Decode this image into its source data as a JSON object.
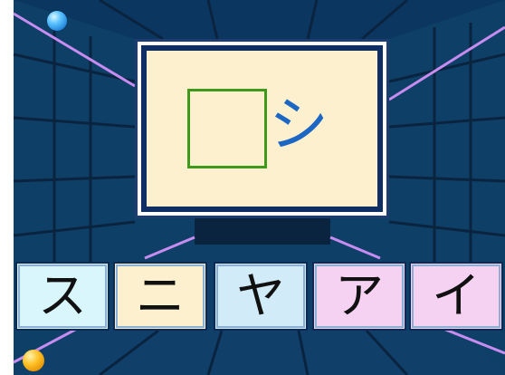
{
  "question": {
    "given_kana": "シ",
    "blank_slot": "empty"
  },
  "choices": [
    {
      "kana": "ス"
    },
    {
      "kana": "ニ"
    },
    {
      "kana": "ヤ"
    },
    {
      "kana": "ア"
    },
    {
      "kana": "イ"
    }
  ],
  "colors": {
    "background": "#0e3f66",
    "card_fill": "#fdf0cf",
    "card_border": "#0f2e64",
    "slot_border": "#3f9a1b",
    "given_kana": "#1c66c4",
    "neon_line": "#c78cf0"
  }
}
